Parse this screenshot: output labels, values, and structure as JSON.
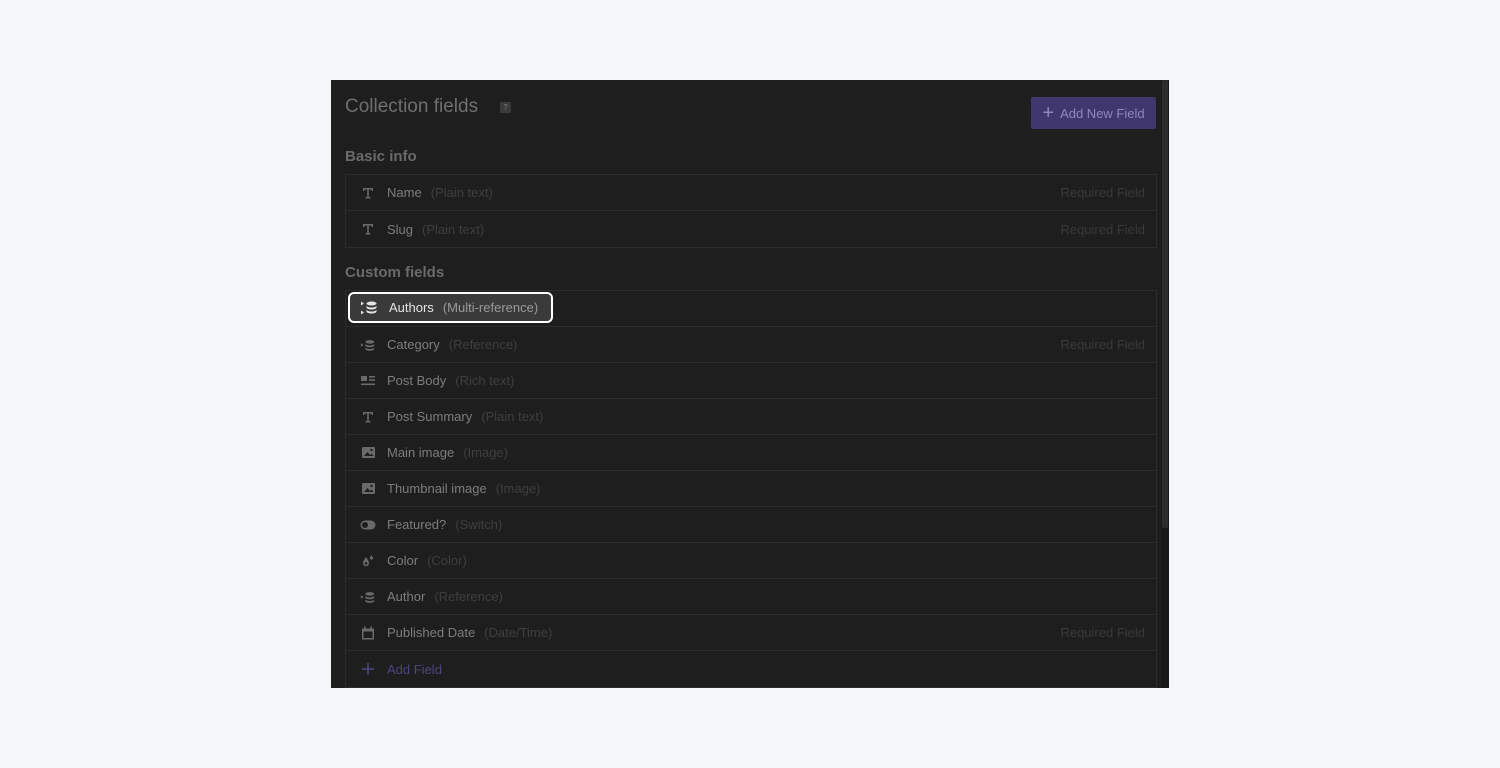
{
  "header": {
    "title": "Collection fields",
    "help_label": "?",
    "add_new_button_label": "Add New Field"
  },
  "basic_info": {
    "section_title": "Basic info",
    "fields": [
      {
        "name": "Name",
        "type": "(Plain text)",
        "required": "Required Field",
        "icon": "text-icon"
      },
      {
        "name": "Slug",
        "type": "(Plain text)",
        "required": "Required Field",
        "icon": "text-icon"
      }
    ]
  },
  "custom_fields": {
    "section_title": "Custom fields",
    "fields": [
      {
        "name": "Authors",
        "type": "(Multi-reference)",
        "required": "",
        "icon": "multi-reference-icon",
        "highlighted": true
      },
      {
        "name": "Category",
        "type": "(Reference)",
        "required": "Required Field",
        "icon": "reference-icon"
      },
      {
        "name": "Post Body",
        "type": "(Rich text)",
        "required": "",
        "icon": "rich-text-icon"
      },
      {
        "name": "Post Summary",
        "type": "(Plain text)",
        "required": "",
        "icon": "text-icon"
      },
      {
        "name": "Main image",
        "type": "(Image)",
        "required": "",
        "icon": "image-icon"
      },
      {
        "name": "Thumbnail image",
        "type": "(Image)",
        "required": "",
        "icon": "image-icon"
      },
      {
        "name": "Featured?",
        "type": "(Switch)",
        "required": "",
        "icon": "switch-icon"
      },
      {
        "name": "Color",
        "type": "(Color)",
        "required": "",
        "icon": "color-drop-icon"
      },
      {
        "name": "Author",
        "type": "(Reference)",
        "required": "",
        "icon": "reference-icon"
      },
      {
        "name": "Published Date",
        "type": "(Date/Time)",
        "required": "Required Field",
        "icon": "calendar-icon"
      }
    ],
    "add_field_label": "Add Field"
  }
}
